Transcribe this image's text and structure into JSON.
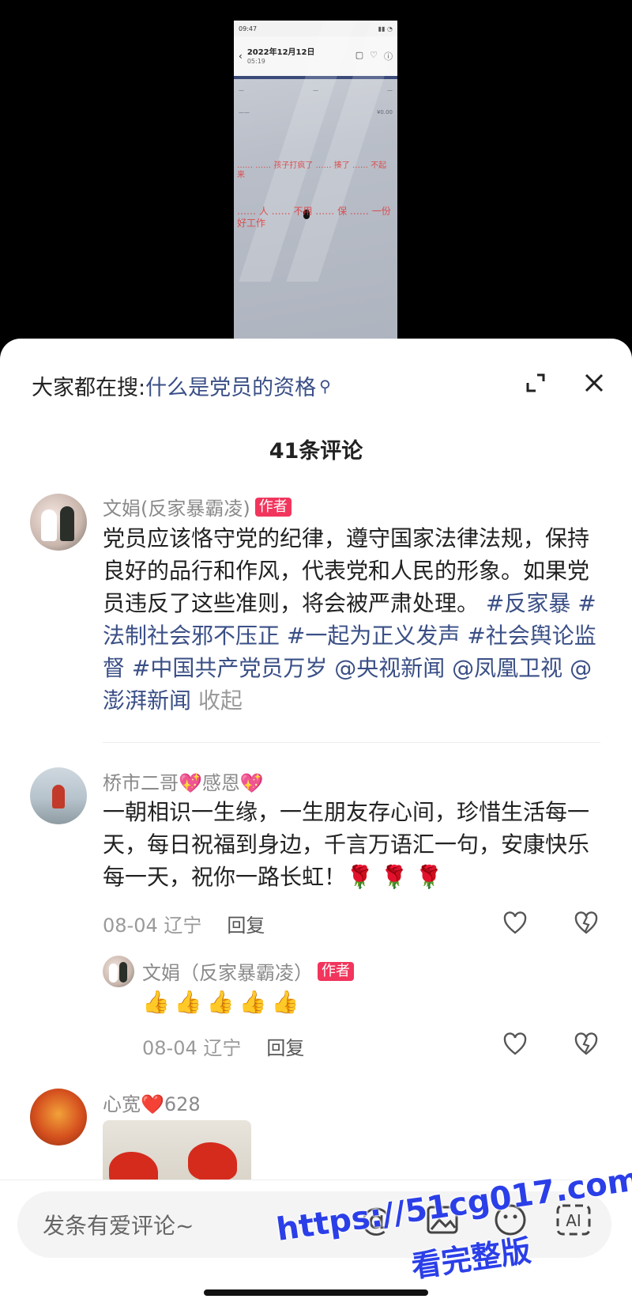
{
  "video": {
    "status_time": "09:47",
    "header_date": "2022年12月12日",
    "header_time": "05:19",
    "overlay_text_1": "…… …… 孩子打疯了 …… 揍了 …… 不起来",
    "overlay_text_2": "…… 人 …… 不用 …… 保 …… 一份好工作"
  },
  "search": {
    "prefix": "大家都在搜:",
    "query": "什么是党员的资格"
  },
  "comments_count": "41条评论",
  "comments": [
    {
      "user": "文娟(反家暴霸凌)",
      "badge": "作者",
      "text_plain": "党员应该恪守党的纪律，遵守国家法律法规，保持良好的品行和作风，代表党和人民的形象。如果党员违反了这些准则，将会被严肃处理。",
      "tags": "#反家暴 #法制社会邪不压正 #一起为正义发声 #社会舆论监督 #中国共产党员万岁 @央视新闻 @凤凰卫视 @澎湃新闻",
      "collapse": "收起"
    },
    {
      "user": "桥市二哥💖感恩💖",
      "text": "一朝相识一生缘，一生朋友存心间，珍惜生活每一天，每日祝福到身边，千言万语汇一句，安康快乐每一天，祝你一路长虹！🌹 🌹 🌹",
      "date_loc": "08-04 辽宁",
      "reply": "回复"
    },
    {
      "user": "文娟（反家暴霸凌）",
      "badge": "作者",
      "text": "👍👍👍👍👍",
      "date_loc": "08-04 辽宁",
      "reply": "回复"
    },
    {
      "user": "心宽❤️628"
    }
  ],
  "input": {
    "placeholder": "发条有爱评论~"
  },
  "watermark": {
    "line1": "https://51cg017.com",
    "line2": "看完整版"
  }
}
